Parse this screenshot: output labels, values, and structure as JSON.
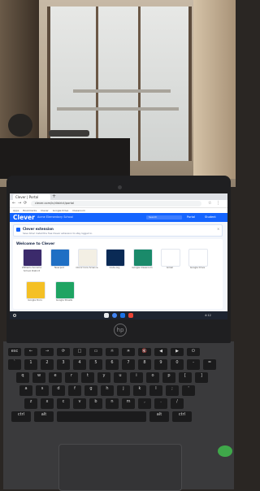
{
  "browser": {
    "tab_title": "Clever | Portal",
    "new_tab": "+",
    "url": "clever.com/in/district/portal",
    "nav_back": "←",
    "nav_forward": "→",
    "nav_reload": "⟳",
    "bookmarks": [
      "Apps",
      "Bookmarks",
      "Clever",
      "Google Drive",
      "Classroom"
    ]
  },
  "clever": {
    "logo": "Clever",
    "district_name": "Acme Elementary School",
    "search_placeholder": "Search",
    "portal_label": "Portal",
    "user_label": "Student"
  },
  "banner": {
    "title": "Clever extension",
    "body": "Save time! Install the free Clever extension to stay logged in.",
    "close": "×"
  },
  "welcome": {
    "heading": "Welcome to Clever"
  },
  "apps": [
    {
      "name": "Williams Sonoma",
      "sub": "Williams Sonoma School District",
      "color": "#3b2a6b"
    },
    {
      "name": "Nearpod",
      "sub": "",
      "color": "#1f6fc4"
    },
    {
      "name": "CK-12",
      "sub": "CK-12 Core Science",
      "color": "#f3efe4"
    },
    {
      "name": "Code.org",
      "sub": "",
      "color": "#0a2a55"
    },
    {
      "name": "Google Classroom",
      "sub": "",
      "color": "#1a8a6a"
    },
    {
      "name": "Gmail",
      "sub": "",
      "color": "#ffffff"
    },
    {
      "name": "Google Drive",
      "sub": "",
      "color": "#ffffff"
    },
    {
      "name": "Google Docs",
      "sub": "",
      "color": "#f4c025"
    },
    {
      "name": "Google Sheets",
      "sub": "",
      "color": "#1fa463"
    }
  ],
  "shelf": {
    "time": "4:12"
  },
  "laptop": {
    "brand": "hp"
  },
  "keyboard": {
    "row1": [
      "esc",
      "←",
      "→",
      "⟳",
      "□",
      "▭",
      "☼",
      "☀",
      "🔇",
      "◀",
      "▶",
      "⏻"
    ],
    "row2": [
      "`",
      "1",
      "2",
      "3",
      "4",
      "5",
      "6",
      "7",
      "8",
      "9",
      "0",
      "-",
      "="
    ],
    "row3": [
      "q",
      "w",
      "e",
      "r",
      "t",
      "y",
      "u",
      "i",
      "o",
      "p",
      "[",
      "]"
    ],
    "row4": [
      "a",
      "s",
      "d",
      "f",
      "g",
      "h",
      "j",
      "k",
      "l",
      ";",
      "'"
    ],
    "row5": [
      "z",
      "x",
      "c",
      "v",
      "b",
      "n",
      "m",
      ",",
      ".",
      "/"
    ],
    "row6": [
      "ctrl",
      "alt",
      "",
      "alt",
      "ctrl"
    ]
  }
}
